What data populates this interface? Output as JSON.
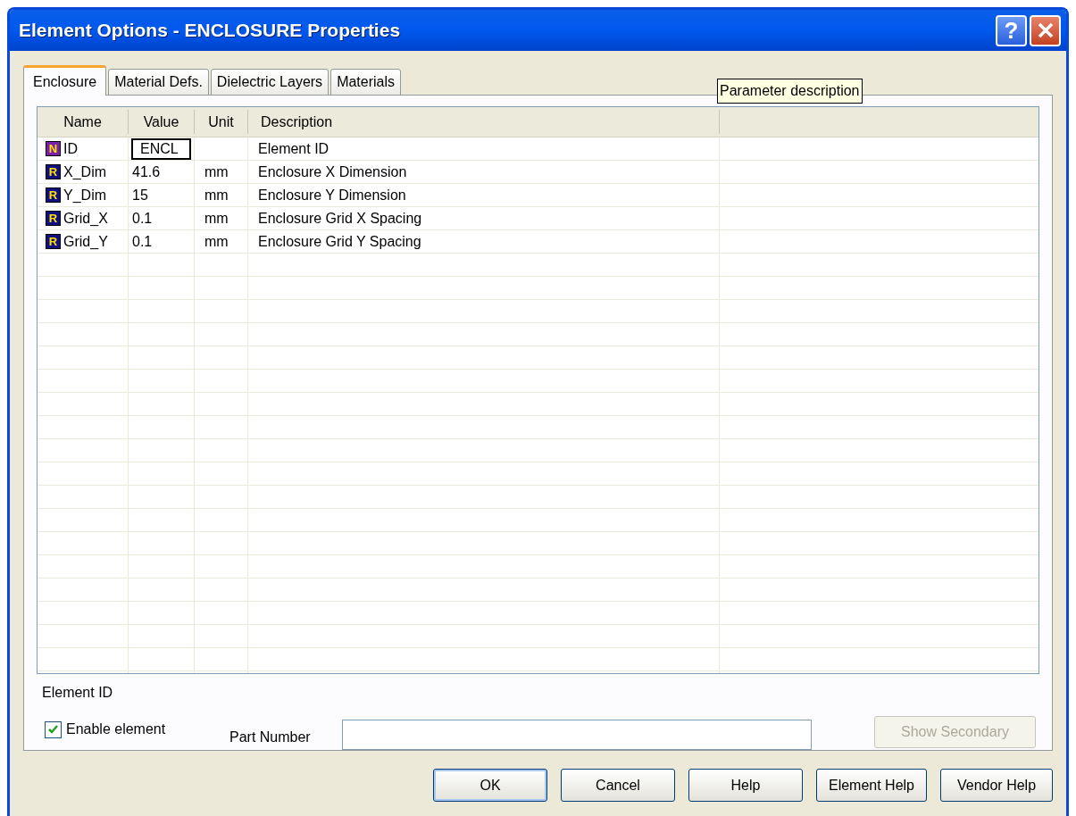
{
  "window": {
    "title": "Element Options - ENCLOSURE Properties",
    "help_button": "?"
  },
  "tabs": [
    {
      "label": "Enclosure",
      "selected": true
    },
    {
      "label": "Material Defs.",
      "selected": false
    },
    {
      "label": "Dielectric Layers",
      "selected": false
    },
    {
      "label": "Materials",
      "selected": false
    }
  ],
  "tooltip": "Parameter description",
  "table": {
    "columns": [
      "Name",
      "Value",
      "Unit",
      "Description"
    ],
    "rows": [
      {
        "kind": "name",
        "badge": "N",
        "name": "ID",
        "value": "ENCL",
        "unit": "",
        "description": "Element ID",
        "focused": true
      },
      {
        "kind": "real",
        "badge": "R",
        "name": "X_Dim",
        "value": "41.6",
        "unit": "mm",
        "description": "Enclosure X Dimension",
        "focused": false
      },
      {
        "kind": "real",
        "badge": "R",
        "name": "Y_Dim",
        "value": "15",
        "unit": "mm",
        "description": "Enclosure Y Dimension",
        "focused": false
      },
      {
        "kind": "real",
        "badge": "R",
        "name": "Grid_X",
        "value": "0.1",
        "unit": "mm",
        "description": "Enclosure Grid X Spacing",
        "focused": false
      },
      {
        "kind": "real",
        "badge": "R",
        "name": "Grid_Y",
        "value": "0.1",
        "unit": "mm",
        "description": "Enclosure Grid Y Spacing",
        "focused": false
      }
    ]
  },
  "status_label": "Element ID",
  "enable_element": {
    "label": "Enable element",
    "checked": true
  },
  "part_number": {
    "label": "Part Number"
  },
  "show_secondary": {
    "label": "Show Secondary",
    "disabled": true
  },
  "buttons": [
    {
      "label": "OK",
      "default": true
    },
    {
      "label": "Cancel",
      "default": false
    },
    {
      "label": "Help",
      "default": false
    },
    {
      "label": "Element Help",
      "default": false
    },
    {
      "label": "Vendor Help",
      "default": false
    }
  ]
}
